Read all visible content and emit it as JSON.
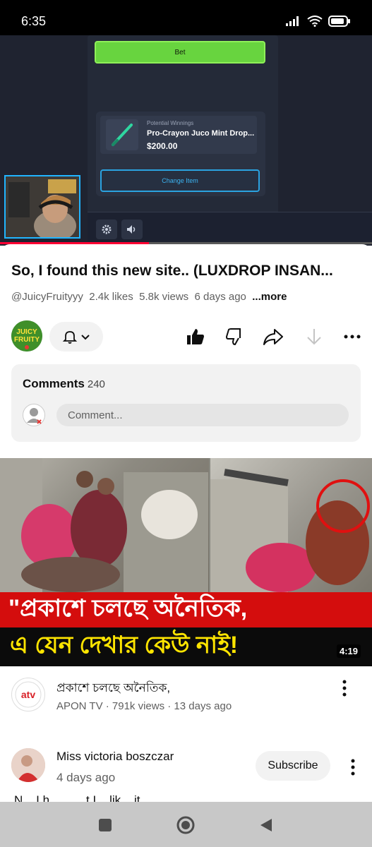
{
  "status_bar": {
    "time": "6:35",
    "battery": "battery-icon",
    "wifi": "wifi-icon",
    "signal": "signal-icon"
  },
  "player": {
    "bet_label": "Bet",
    "potential_winnings_label": "Potential Winnings",
    "item_name": "Pro-Crayon Juco Mint Drop...",
    "item_price": "$200.00",
    "change_item_label": "Change Item",
    "progress_fraction": 0.4
  },
  "video": {
    "title": "So, I found this new site.. (LUXDROP INSAN...",
    "channel_handle": "@JuicyFruityyy",
    "likes": "2.4k likes",
    "views": "5.8k views",
    "age": "6 days ago",
    "more_label": "...more",
    "channel_avatar_text": "JUICY FRUITY"
  },
  "comments": {
    "title": "Comments",
    "count": "240",
    "placeholder": "Comment..."
  },
  "recommendation": {
    "banner_line1": "\"প্রকাশে চলছে অনৈতিক,",
    "banner_line2": "এ যেন  দেখার কেউ নাই!",
    "duration": "4:19",
    "title": "প্রকাশে চলছে অনৈতিক,",
    "meta": "APON TV · 791k views · 13 days ago",
    "channel_logo_text": "atv"
  },
  "comment_item": {
    "name": "Miss victoria boszczar",
    "time": "4 days ago",
    "subscribe_label": "Subscribe",
    "snippet": "N... I h... ... ...t I... lik... it..."
  }
}
